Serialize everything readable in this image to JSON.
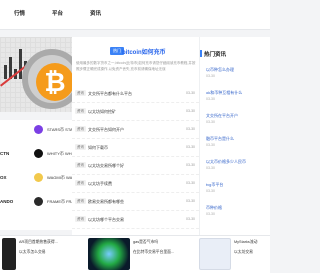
{
  "nav": {
    "items": [
      "行情",
      "平台",
      "资讯"
    ]
  },
  "hero": {
    "coin_symbol": "₿",
    "accent_line": "#d93b3b",
    "coin_color": "#f59b1b"
  },
  "coin_list": [
    {
      "symbol": "",
      "name": "STARS币 STARS",
      "color": "#7b3fe4"
    },
    {
      "symbol": "CTN",
      "name": "WHITY币 WHITY",
      "color": "#111111"
    },
    {
      "symbol": "OX",
      "name": "WAGMI币 WAGMI",
      "color": "#f2c94c"
    },
    {
      "symbol": "ANDO",
      "name": "FRAME币 FRA",
      "color": "#2a2a2a"
    }
  ],
  "main": {
    "badge": "热门",
    "title": "bitcoin如何充币",
    "desc": "使用最多的数字货币之一,bitcoin(比特币)如何充币请您仔细阅读充币教程,并按照步骤正确完成操作,以免资产丢失,充币前请确保地址无误",
    "rows": [
      {
        "tag": "资讯",
        "title": "文交所平台都有什么平台",
        "date": "03-30"
      },
      {
        "tag": "资讯",
        "title": "以太坊如何挖矿",
        "date": "03-30"
      },
      {
        "tag": "资讯",
        "title": "文交所平台如何开户",
        "date": "03-30"
      },
      {
        "tag": "资讯",
        "title": "如何下载币",
        "date": "03-30"
      },
      {
        "tag": "资讯",
        "title": "以太坊交易所哪个好",
        "date": "03-30"
      },
      {
        "tag": "资讯",
        "title": "以太坊手续费",
        "date": "03-30"
      },
      {
        "tag": "资讯",
        "title": "欧易交易所都有哪些",
        "date": "03-30"
      },
      {
        "tag": "资讯",
        "title": "以太坊哪个平台交易",
        "date": "03-30"
      }
    ]
  },
  "hot": {
    "heading": "热门资讯",
    "items": [
      {
        "title": "以币种怎么办理",
        "date": "03-30"
      },
      {
        "title": "ok和币种互相有什么",
        "date": "03-30"
      },
      {
        "title": "文交所在平台开户",
        "date": "03-30"
      },
      {
        "title": "融币平台是什么",
        "date": "03-30"
      },
      {
        "title": "以太币价格多少人民币",
        "date": "03-30"
      },
      {
        "title": "tvg币平台",
        "date": "03-30"
      },
      {
        "title": "币种价格",
        "date": "03-30"
      }
    ]
  },
  "bottom": {
    "cards": [
      {
        "line1": "AR项目首期热售获得...",
        "line2": "以太币怎么交易"
      },
      {
        "line1": "gas是否气市吗",
        "line2": "在比特币交易平台里面..."
      },
      {
        "line1": "MyStarks流动",
        "line2": "以太坊交易"
      }
    ]
  }
}
